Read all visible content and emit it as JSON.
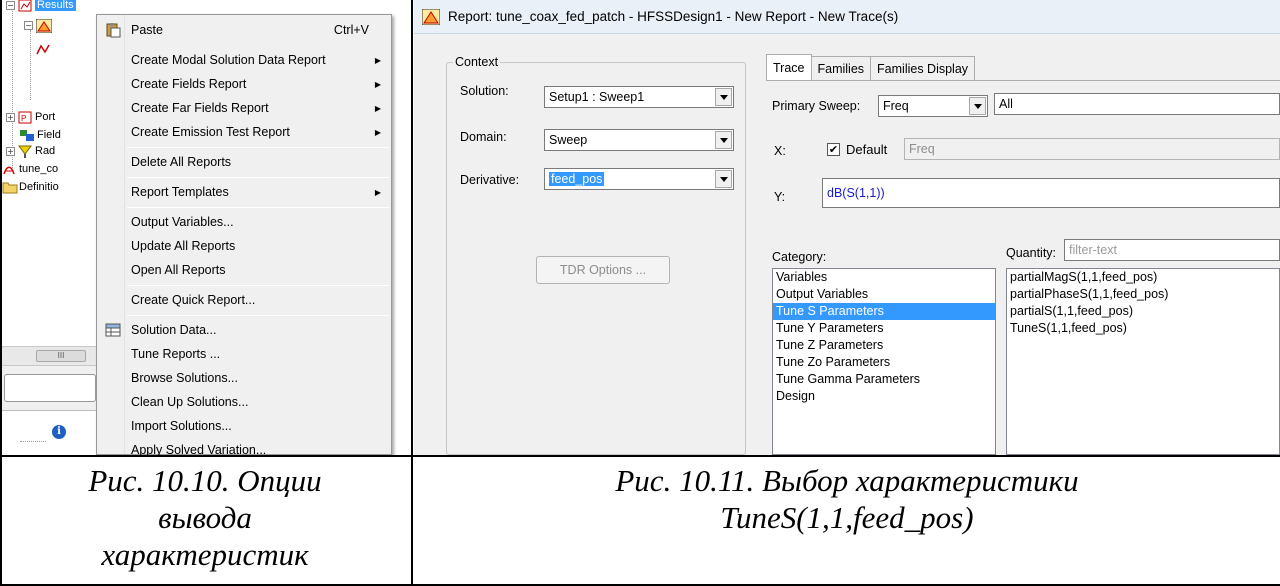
{
  "tree": {
    "results_label": "Results",
    "items": [
      "Port",
      "Field",
      "Rad",
      "tune_co",
      "Definitio"
    ],
    "scroll_grip": "III"
  },
  "context_menu": {
    "items": [
      {
        "label": "Paste",
        "shortcut": "Ctrl+V",
        "icon": "paste-icon"
      },
      {
        "label": "Create Modal Solution Data Report",
        "submenu": true
      },
      {
        "label": "Create Fields Report",
        "submenu": true
      },
      {
        "label": "Create Far Fields Report",
        "submenu": true
      },
      {
        "label": "Create Emission Test Report",
        "submenu": true
      },
      {
        "label": "Delete All Reports"
      },
      {
        "label": "Report Templates",
        "submenu": true
      },
      {
        "label": "Output Variables..."
      },
      {
        "label": "Update All Reports"
      },
      {
        "label": "Open All Reports"
      },
      {
        "label": "Create Quick Report..."
      },
      {
        "label": "Solution Data...",
        "icon": "table-icon"
      },
      {
        "label": "Tune Reports ..."
      },
      {
        "label": "Browse Solutions..."
      },
      {
        "label": "Clean Up Solutions..."
      },
      {
        "label": "Import Solutions..."
      },
      {
        "label": "Apply Solved Variation..."
      }
    ]
  },
  "dialog": {
    "title": "Report: tune_coax_fed_patch - HFSSDesign1 - New Report - New Trace(s)",
    "context": {
      "group_label": "Context",
      "solution_label": "Solution:",
      "solution_value": "Setup1 : Sweep1",
      "domain_label": "Domain:",
      "domain_value": "Sweep",
      "derivative_label": "Derivative:",
      "derivative_value": "feed_pos",
      "tdr_button": "TDR Options ..."
    },
    "tabs": [
      "Trace",
      "Families",
      "Families Display"
    ],
    "trace": {
      "primary_sweep_label": "Primary Sweep:",
      "primary_sweep_value": "Freq",
      "primary_sweep_all": "All",
      "x_label": "X:",
      "default_label": "Default",
      "default_checked": "✔",
      "x_value": "Freq",
      "y_label": "Y:",
      "y_value": "dB(S(1,1))",
      "category_label": "Category:",
      "categories": [
        "Variables",
        "Output Variables",
        "Tune S Parameters",
        "Tune Y Parameters",
        "Tune Z Parameters",
        "Tune Zo Parameters",
        "Tune Gamma Parameters",
        "Design"
      ],
      "selected_category": "Tune S Parameters",
      "quantity_label": "Quantity:",
      "quantity_filter_placeholder": "filter-text",
      "quantities": [
        "partialMagS(1,1,feed_pos)",
        "partialPhaseS(1,1,feed_pos)",
        "partialS(1,1,feed_pos)",
        "TuneS(1,1,feed_pos)"
      ]
    }
  },
  "captions": {
    "left": [
      "Рис. 10.10. Опции",
      "вывода",
      "характеристик"
    ],
    "right": [
      "Рис. 10.11. Выбор характеристики",
      "TuneS(1,1,feed_pos)"
    ]
  }
}
